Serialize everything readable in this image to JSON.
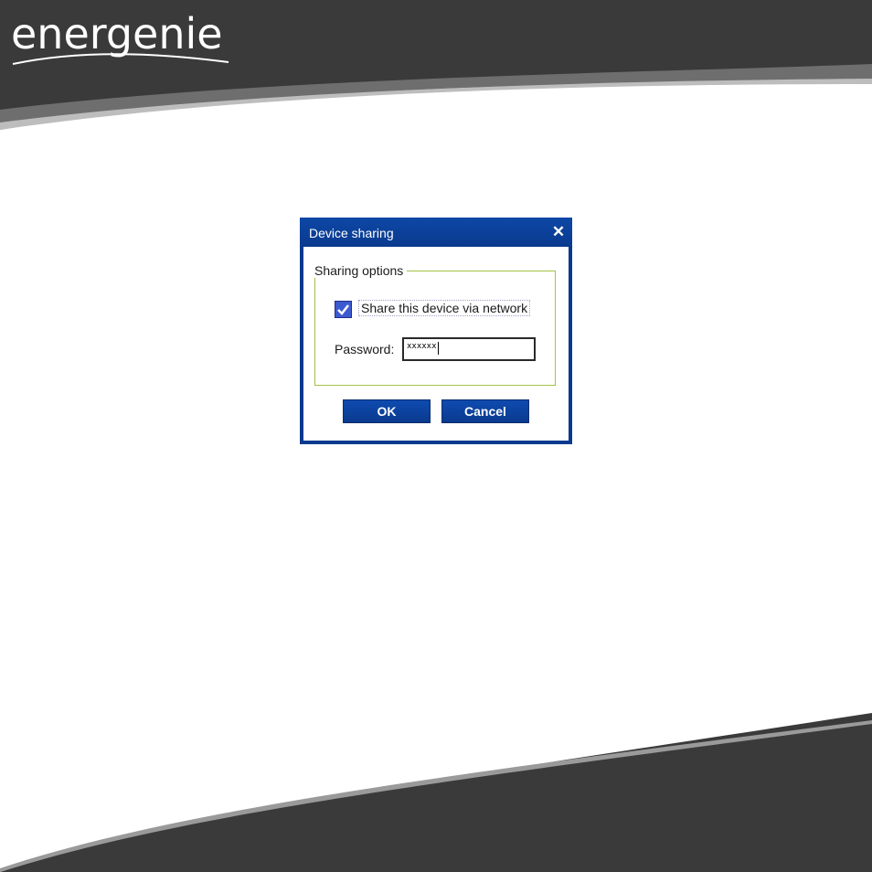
{
  "brand": {
    "logo_text": "energenie"
  },
  "colors": {
    "band": "#3a3a3a",
    "dialog_blue": "#0a3a8e",
    "groupbox_border": "#a3c247"
  },
  "dialog": {
    "title": "Device sharing",
    "close_icon": "close-icon",
    "group_title": "Sharing options",
    "share_checkbox": {
      "label": "Share this device via network",
      "checked": true
    },
    "password": {
      "label": "Password:",
      "value": "xxxxxx"
    },
    "ok_label": "OK",
    "cancel_label": "Cancel"
  }
}
